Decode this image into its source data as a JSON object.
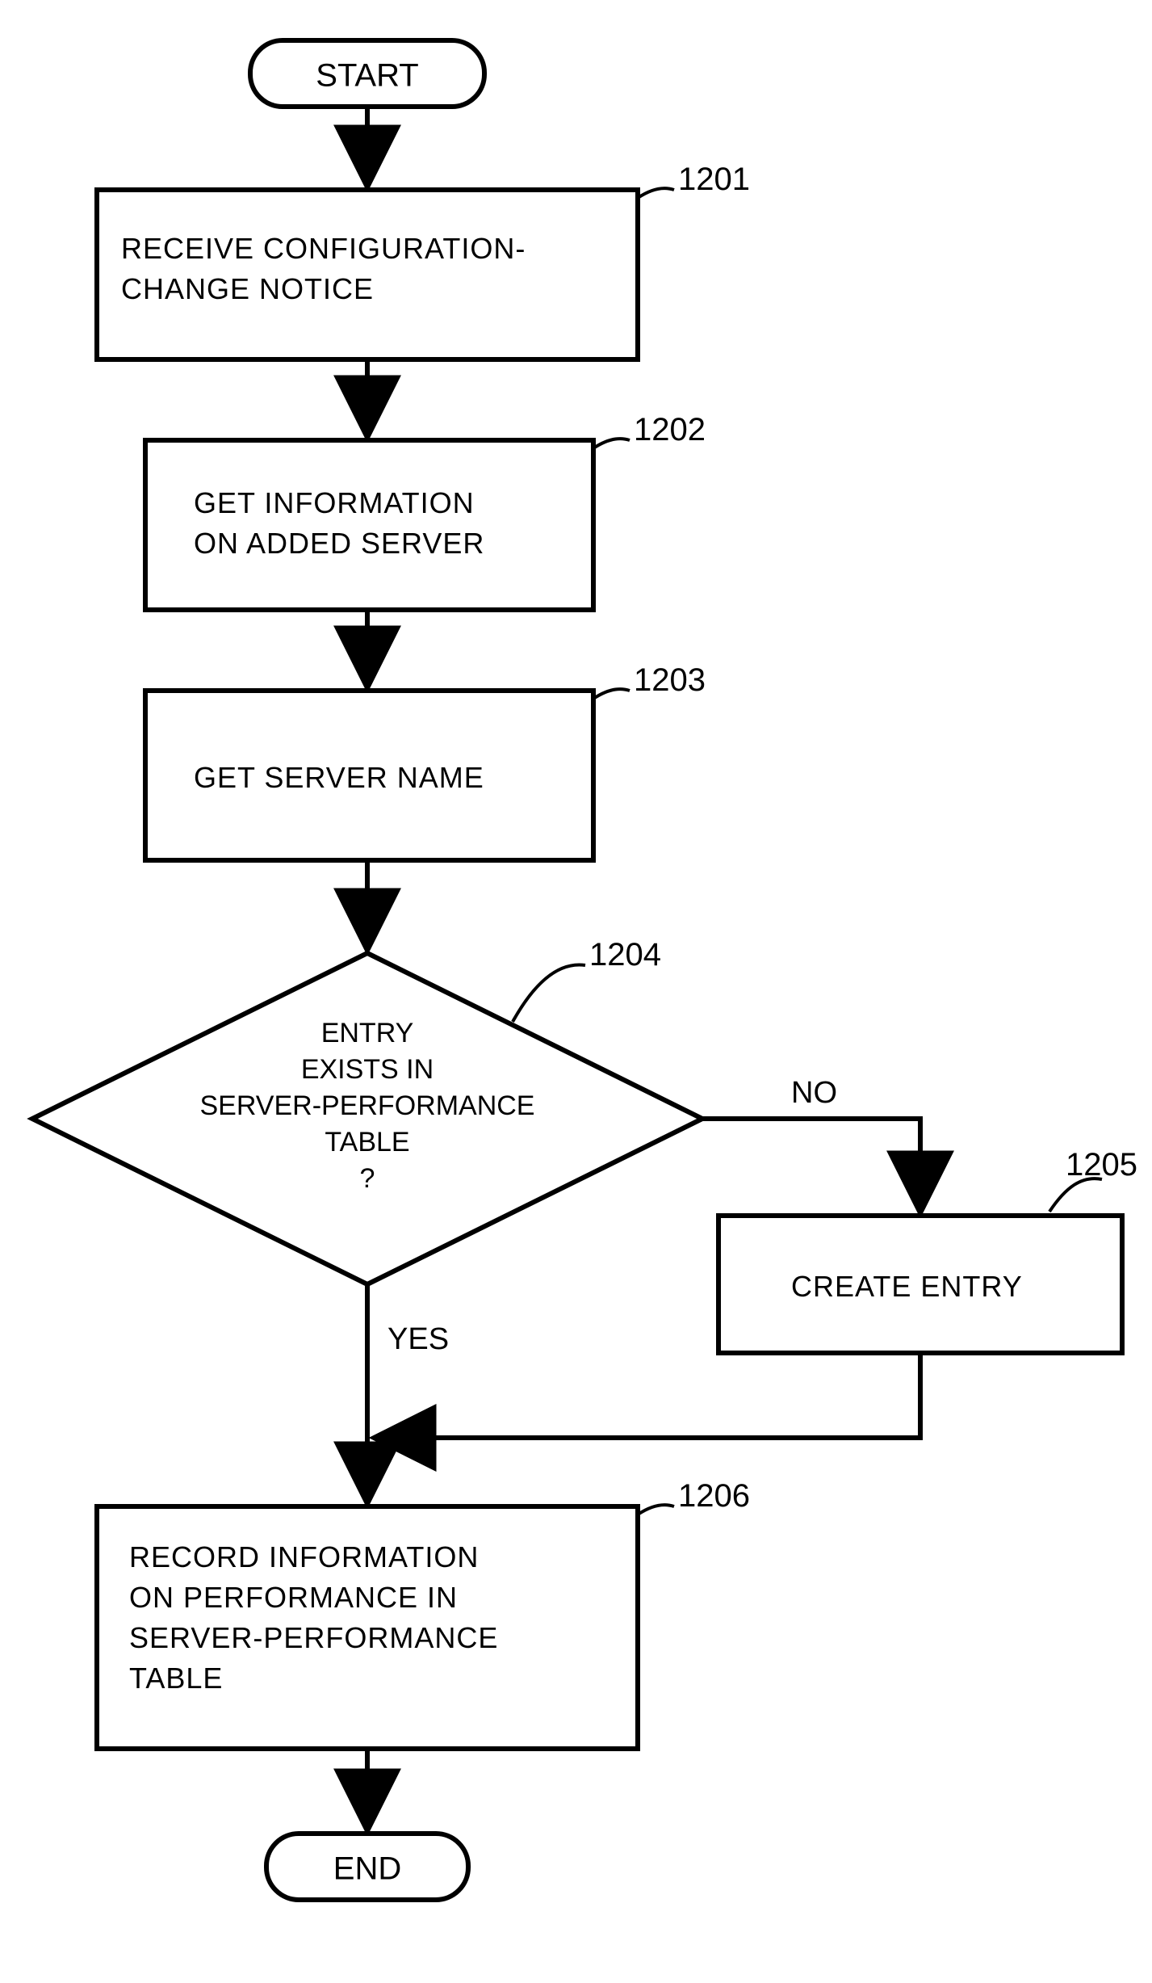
{
  "chart_data": {
    "type": "flowchart",
    "nodes": [
      {
        "id": "start",
        "type": "terminator",
        "label": "START"
      },
      {
        "id": "1201",
        "type": "process",
        "ref": "1201",
        "label": "RECEIVE CONFIGURATION-\nCHANGE NOTICE"
      },
      {
        "id": "1202",
        "type": "process",
        "ref": "1202",
        "label": "GET INFORMATION\nON ADDED SERVER"
      },
      {
        "id": "1203",
        "type": "process",
        "ref": "1203",
        "label": "GET SERVER NAME"
      },
      {
        "id": "1204",
        "type": "decision",
        "ref": "1204",
        "label": "ENTRY\nEXISTS IN\nSERVER-PERFORMANCE\nTABLE\n?"
      },
      {
        "id": "1205",
        "type": "process",
        "ref": "1205",
        "label": "CREATE ENTRY"
      },
      {
        "id": "1206",
        "type": "process",
        "ref": "1206",
        "label": "RECORD INFORMATION\nON PERFORMANCE IN\nSERVER-PERFORMANCE\nTABLE"
      },
      {
        "id": "end",
        "type": "terminator",
        "label": "END"
      }
    ],
    "edges": [
      {
        "from": "start",
        "to": "1201"
      },
      {
        "from": "1201",
        "to": "1202"
      },
      {
        "from": "1202",
        "to": "1203"
      },
      {
        "from": "1203",
        "to": "1204"
      },
      {
        "from": "1204",
        "to": "1205",
        "label": "NO"
      },
      {
        "from": "1204",
        "to": "1206",
        "label": "YES"
      },
      {
        "from": "1205",
        "to": "1206"
      },
      {
        "from": "1206",
        "to": "end"
      }
    ]
  },
  "labels": {
    "start": "START",
    "end": "END",
    "yes": "YES",
    "no": "NO",
    "n1201_l1": "RECEIVE CONFIGURATION-",
    "n1201_l2": "CHANGE NOTICE",
    "n1202_l1": "GET INFORMATION",
    "n1202_l2": "ON ADDED SERVER",
    "n1203_l1": "GET SERVER NAME",
    "n1204_l1": "ENTRY",
    "n1204_l2": "EXISTS IN",
    "n1204_l3": "SERVER-PERFORMANCE",
    "n1204_l4": "TABLE",
    "n1204_l5": "?",
    "n1205_l1": "CREATE ENTRY",
    "n1206_l1": "RECORD INFORMATION",
    "n1206_l2": "ON PERFORMANCE IN",
    "n1206_l3": "SERVER-PERFORMANCE",
    "n1206_l4": "TABLE",
    "r1201": "1201",
    "r1202": "1202",
    "r1203": "1203",
    "r1204": "1204",
    "r1205": "1205",
    "r1206": "1206"
  }
}
